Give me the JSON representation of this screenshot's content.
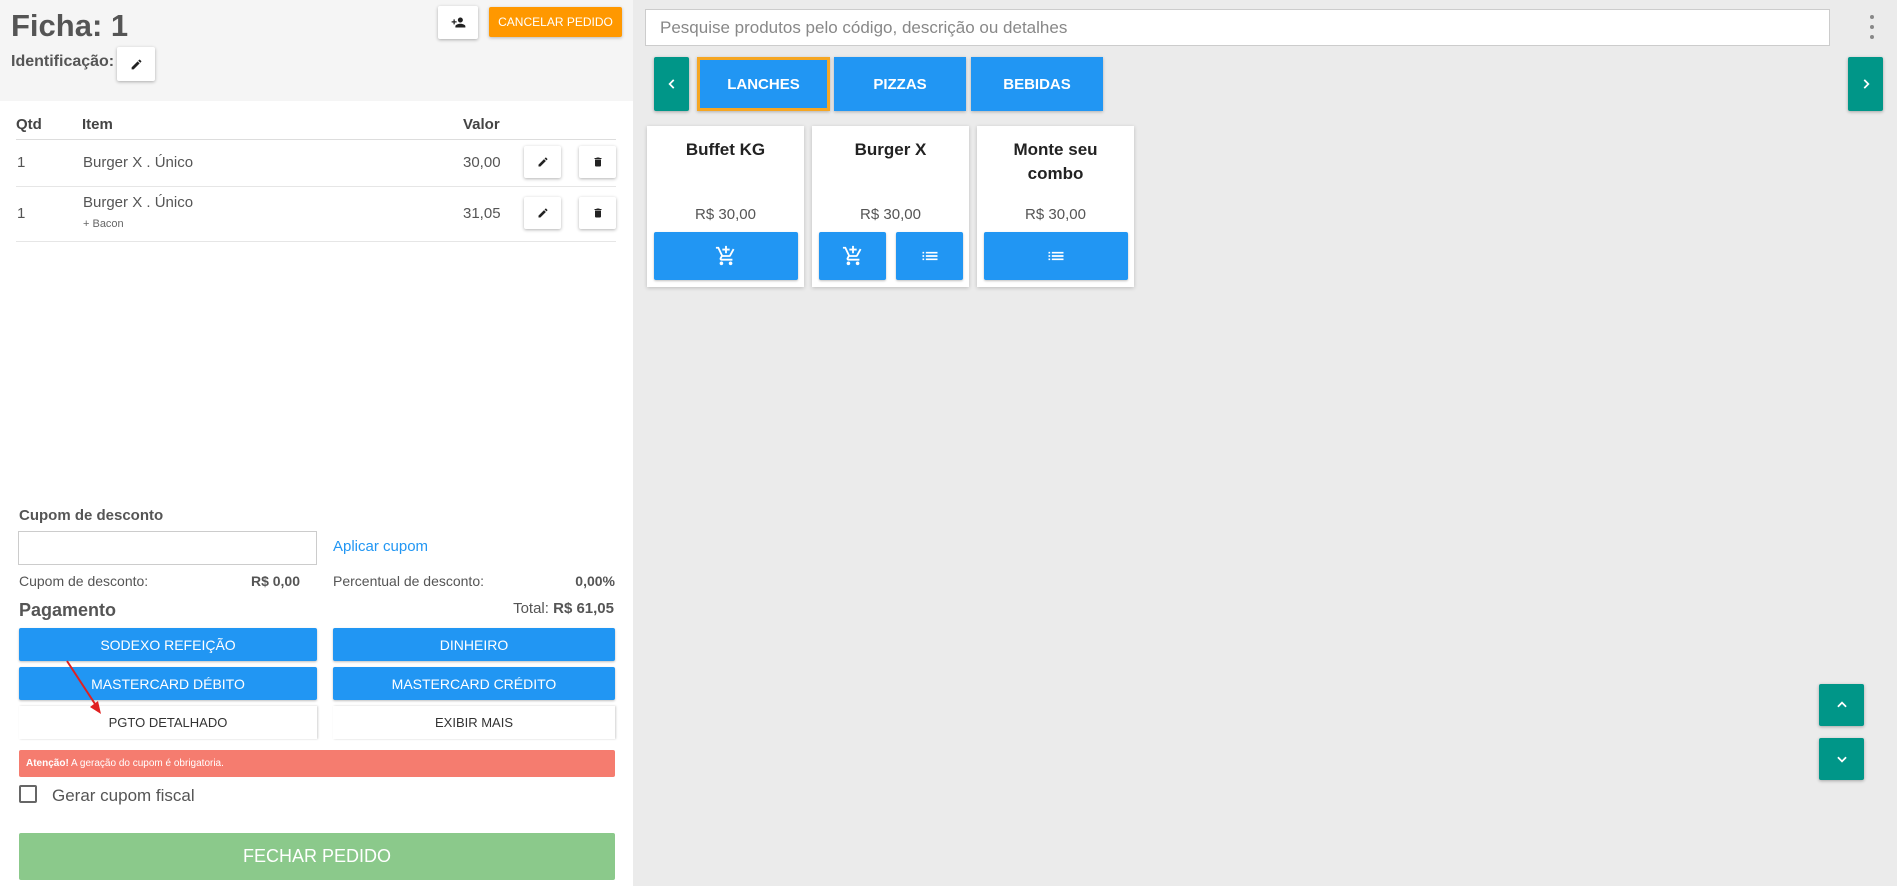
{
  "order": {
    "title": "Ficha: 1",
    "identification_label": "Identificação:",
    "cancel_label": "CANCELAR PEDIDO"
  },
  "items_table": {
    "headers": {
      "qty": "Qtd",
      "item": "Item",
      "value": "Valor"
    },
    "rows": [
      {
        "qty": "1",
        "name": "Burger X . Único",
        "addon": "",
        "value": "30,00"
      },
      {
        "qty": "1",
        "name": "Burger X . Único",
        "addon": "+ Bacon",
        "value": "31,05"
      }
    ]
  },
  "coupon": {
    "section_label": "Cupom de desconto",
    "input_value": "",
    "apply_label": "Aplicar cupom",
    "discount_label": "Cupom de desconto:",
    "discount_value": "R$ 0,00",
    "percent_label": "Percentual de desconto:",
    "percent_value": "0,00%"
  },
  "payment": {
    "label": "Pagamento",
    "total_label": "Total:",
    "total_value": "R$ 61,05",
    "methods": [
      "SODEXO REFEIÇÃO",
      "DINHEIRO",
      "MASTERCARD DÉBITO",
      "MASTERCARD CRÉDITO"
    ],
    "detailed_label": "PGTO DETALHADO",
    "show_more_label": "EXIBIR MAIS"
  },
  "warning": {
    "bold": "Atenção!",
    "text": " A geração do cupom é obrigatoria."
  },
  "fiscal": {
    "label": "Gerar cupom fiscal",
    "checked": false
  },
  "close_order_label": "FECHAR PEDIDO",
  "search": {
    "placeholder": "Pesquise produtos pelo código, descrição ou detalhes",
    "value": ""
  },
  "categories": [
    {
      "label": "LANCHES",
      "active": true
    },
    {
      "label": "PIZZAS",
      "active": false
    },
    {
      "label": "BEBIDAS",
      "active": false
    }
  ],
  "products": [
    {
      "name": "Buffet KG",
      "price": "R$ 30,00",
      "actions": [
        "add-to-cart-icon"
      ]
    },
    {
      "name": "Burger X",
      "price": "R$ 30,00",
      "actions": [
        "add-to-cart-icon",
        "list-icon"
      ]
    },
    {
      "name": "Monte seu combo",
      "price": "R$ 30,00",
      "actions": [
        "list-icon"
      ]
    }
  ],
  "colors": {
    "primary": "#2196f3",
    "accent_teal": "#009688",
    "cancel_orange": "#ff9800",
    "active_tab_border": "#f5a623",
    "warning": "#f57c6f",
    "close_green": "#8bc98b",
    "annotation_arrow": "#e02020"
  }
}
